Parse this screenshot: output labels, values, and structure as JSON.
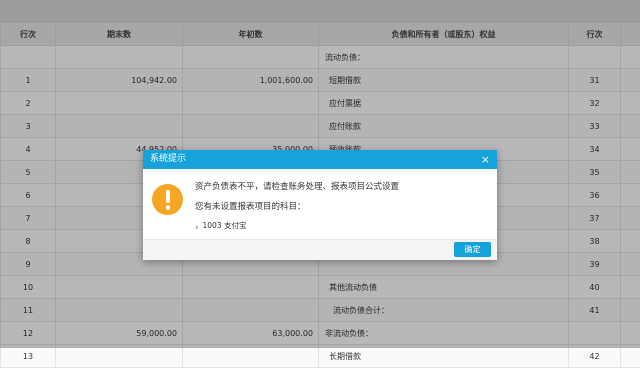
{
  "table": {
    "headers": [
      "行次",
      "期末数",
      "年初数",
      "负债和所有者（或股东）权益",
      "行次"
    ],
    "rows": [
      [
        "",
        "",
        "",
        "流动负债：",
        ""
      ],
      [
        "1",
        "104,942.00",
        "1,001,600.00",
        "短期借款",
        "31"
      ],
      [
        "2",
        "",
        "",
        "应付票据",
        "32"
      ],
      [
        "3",
        "",
        "",
        "应付账款",
        "33"
      ],
      [
        "4",
        "44,952.00",
        "35,000.00",
        "预收账款",
        "34"
      ],
      [
        "5",
        "",
        "",
        "",
        "35"
      ],
      [
        "6",
        "",
        "",
        "",
        "36"
      ],
      [
        "7",
        "",
        "",
        "",
        "37"
      ],
      [
        "8",
        "",
        "",
        "",
        "38"
      ],
      [
        "9",
        "",
        "",
        "",
        "39"
      ],
      [
        "10",
        "",
        "",
        "其他流动负债",
        "40"
      ],
      [
        "11",
        "",
        "",
        "流动负债合计：",
        "41"
      ],
      [
        "12",
        "59,000.00",
        "63,000.00",
        "非流动负债：",
        ""
      ],
      [
        "13",
        "",
        "",
        "长期借款",
        "42"
      ]
    ]
  },
  "dialog": {
    "title": "系统提示",
    "close": "×",
    "message": "资产负债表不平，请检查账务处理、报表项目公式设置",
    "sub_message": "您有未设置报表项目的科目：",
    "item": "，1003 支付宝",
    "ok_label": "确定",
    "warning_color": "#f5a623",
    "accent_color": "#16a3dc"
  }
}
